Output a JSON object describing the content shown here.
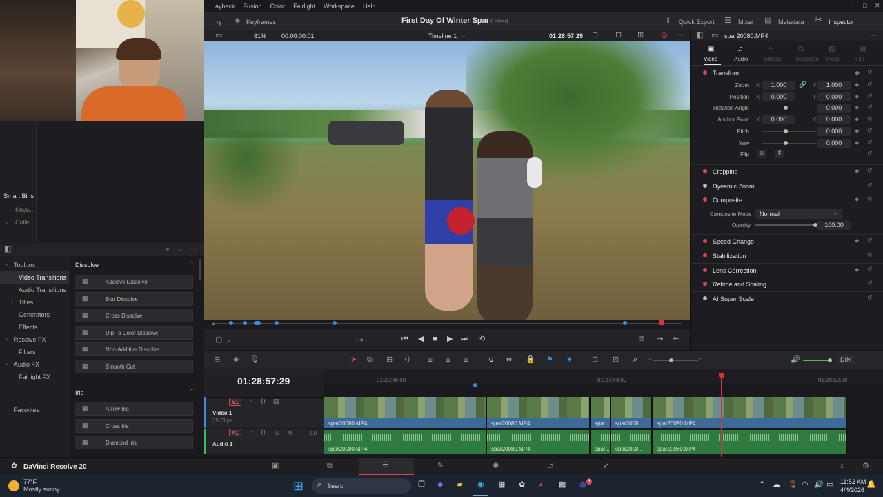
{
  "menu": [
    "ayback",
    "Fusion",
    "Color",
    "Fairlight",
    "Workspace",
    "Help"
  ],
  "topbar": {
    "left_label": "ry",
    "keyframes": "Keyframes",
    "project_title": "First Day Of Winter Spar",
    "edited": "Edited",
    "quick_export": "Quick Export",
    "mixer": "Mixer",
    "metadata": "Metadata",
    "inspector": "Inspector"
  },
  "viewer_bar": {
    "zoom": "61%",
    "timecode_start": "00:00:00:01",
    "timeline": "Timeline 1",
    "timecode_current": "01:28:57:29"
  },
  "left_panel": {
    "smart_bins": "Smart Bins",
    "smart_items": [
      "Keyw...",
      "Colle..."
    ],
    "toolbox_tree": [
      {
        "label": "Toolbox",
        "indent": 0,
        "arrow": true
      },
      {
        "label": "Video Transitions",
        "indent": 1,
        "selected": true
      },
      {
        "label": "Audio Transitions",
        "indent": 1
      },
      {
        "label": "Titles",
        "indent": 1,
        "arrow": true
      },
      {
        "label": "Generators",
        "indent": 1
      },
      {
        "label": "Effects",
        "indent": 1
      },
      {
        "label": "Resolve FX",
        "indent": 0,
        "arrow": true
      },
      {
        "label": "Filters",
        "indent": 1
      },
      {
        "label": "Audio FX",
        "indent": 0,
        "arrow": true
      },
      {
        "label": "Fairlight FX",
        "indent": 1
      }
    ],
    "favorites": "Favorites",
    "dissolve_header": "Dissolve",
    "dissolve_items": [
      "Additive Dissolve",
      "Blur Dissolve",
      "Cross Dissolve",
      "Dip To Color Dissolve",
      "Non-Additive Dissolve",
      "Smooth Cut"
    ],
    "iris_header": "Iris",
    "iris_items": [
      "Arrow Iris",
      "Cross Iris",
      "Diamond Iris"
    ]
  },
  "inspector": {
    "clip_name": "spar20080.MP4",
    "tabs": [
      "Video",
      "Audio",
      "Effects",
      "Transition",
      "Image",
      "File"
    ],
    "transform": {
      "title": "Transform",
      "rows": [
        {
          "label": "Zoom",
          "x": "1.000",
          "y": "1.000"
        },
        {
          "label": "Position",
          "x": "0.000",
          "y": "0.000"
        },
        {
          "label": "Rotation Angle",
          "v": "0.000"
        },
        {
          "label": "Anchor Point",
          "x": "0.000",
          "y": "0.000"
        },
        {
          "label": "Pitch",
          "v": "0.000"
        },
        {
          "label": "Yaw",
          "v": "0.000"
        },
        {
          "label": "Flip"
        }
      ],
      "x_label": "X",
      "y_label": "Y"
    },
    "cropping": "Cropping",
    "dynamic_zoom": "Dynamic Zoom",
    "composite": "Composite",
    "composite_mode_label": "Composite Mode",
    "composite_mode_value": "Normal",
    "opacity_label": "Opacity",
    "opacity_value": "100.00",
    "sections": [
      "Speed Change",
      "Stabilization",
      "Lens Correction",
      "Retime and Scaling",
      "AI Super Scale"
    ]
  },
  "timeline": {
    "timecode": "01:28:57:29",
    "ruler": [
      "01:25:36:00",
      "01:27:44:00",
      "01:29:52:00"
    ],
    "v1_tag": "V1",
    "video_track": "Video 1",
    "video_clips": "35 Clips",
    "a1_tag": "A1",
    "audio_track": "Audio 1",
    "audio_level": "2.0",
    "clip_names": [
      "spar20080.MP4",
      "spar20080.MP4",
      "spar...",
      "spar2008...",
      "spar20080.MP4"
    ],
    "dim": "DIM"
  },
  "status": {
    "app_name": "DaVinci Resolve 20"
  },
  "taskbar": {
    "temp": "77°F",
    "weather": "Mostly sunny",
    "search": "Search",
    "time": "11:52 AM",
    "date": "4/4/2026",
    "badge": "4"
  },
  "colors": {
    "accent_red": "#e04050",
    "clip_blue": "#3d6a96",
    "clip_green": "#2f7a3e",
    "playhead": "#e0303a"
  }
}
